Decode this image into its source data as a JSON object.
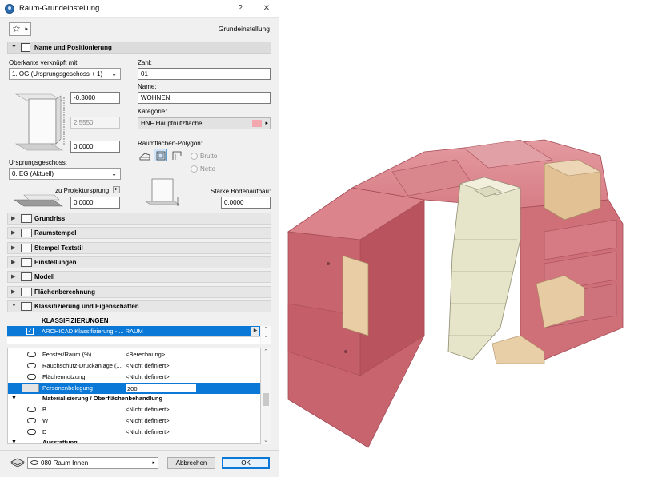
{
  "dialog": {
    "title": "Raum-Grundeinstellung",
    "help_label": "?",
    "close_label": "✕",
    "preset_name": "Grundeinstellung",
    "fav_icon": "star-icon"
  },
  "panel_name_position": {
    "title": "Name und Positionierung",
    "top_linked_label": "Oberkante verknüpft mit:",
    "top_linked_value": "1. OG (Ursprungsgeschoss + 1)",
    "offset_top": "-0.3000",
    "height": "2.5550",
    "offset_bottom": "0.0000",
    "home_story_label": "Ursprungsgeschoss:",
    "home_story_value": "0. EG (Aktuell)",
    "to_origin_label": "zu Projektursprung",
    "to_origin_value": "0.0000",
    "number_label": "Zahl:",
    "number_value": "01",
    "name_label": "Name:",
    "name_value": "WOHNEN",
    "category_label": "Kategorie:",
    "category_value": "HNF  Hauptnutzfläche",
    "category_color": "#f3a7ae",
    "polygon_label": "Raumflächen-Polygon:",
    "gross_label": "Brutto",
    "net_label": "Netto",
    "floor_thickness_label": "Stärke Bodenaufbau:",
    "floor_thickness_value": "0.0000"
  },
  "sections": [
    {
      "label": "Grundriss",
      "icon": "floorplan-icon"
    },
    {
      "label": "Raumstempel",
      "icon": "stamp-icon"
    },
    {
      "label": "Stempel Textstil",
      "icon": "text-style-icon"
    },
    {
      "label": "Einstellungen",
      "icon": "settings-icon"
    },
    {
      "label": "Modell",
      "icon": "model-icon"
    },
    {
      "label": "Flächenberechnung",
      "icon": "area-calc-icon"
    }
  ],
  "classification_panel": {
    "title": "Klassifizierung und Eigenschaften",
    "heading": "KLASSIFIZIERUNGEN",
    "selected_classification": "ARCHICAD Klassifizierung - ... RAUM"
  },
  "properties": [
    {
      "name": "Fenster/Raum (%)",
      "value": "<Berechnung>"
    },
    {
      "name": "Rauchschutz-Druckanlage (...",
      "value": "<Nicht definiert>"
    },
    {
      "name": "Flächennutzung",
      "value": "<Nicht definiert>"
    },
    {
      "name": "Personenbelegung",
      "value": "200"
    }
  ],
  "material_group": {
    "title": "Materialisierung / Oberflächenbehandlung",
    "rows": [
      {
        "name": "B",
        "value": "<Nicht definiert>"
      },
      {
        "name": "W",
        "value": "<Nicht definiert>"
      },
      {
        "name": "D",
        "value": "<Nicht definiert>"
      }
    ]
  },
  "next_group": "Ausstattung",
  "footer": {
    "layer_value": "080 Raum Innen",
    "cancel_label": "Abbrechen",
    "ok_label": "OK"
  },
  "colors": {
    "selection": "#0a78d7",
    "zone_living": "#d9737b",
    "zone_stair": "#e4e4cc",
    "zone_side": "#e6c9a0"
  }
}
